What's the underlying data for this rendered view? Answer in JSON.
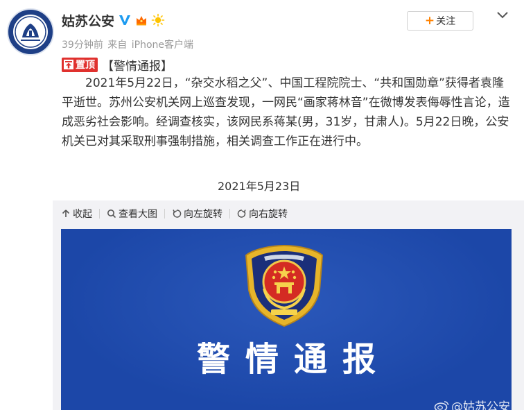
{
  "post": {
    "author_name": "姑苏公安",
    "time": "39分钟前",
    "source_prefix": "来自",
    "source_client": "iPhone客户端",
    "pin_label": "置顶",
    "tag": "【警情通报】",
    "body": "2021年5月22日，“杂交水稻之父”、中国工程院院士、“共和国勋章”获得者袁隆平逝世。苏州公安机关网上巡查发现，一网民“画家蒋林音”在微博发表侮辱性言论，造成恶劣社会影响。经调查核实，该网民系蒋某(男，31岁，甘肃人)。5月22日晚，公安机关已对其采取刑事强制措施，相关调查工作正在进行中。",
    "date": "2021年5月23日"
  },
  "header": {
    "follow_label": "关注",
    "follow_plus": "+"
  },
  "toolbar": {
    "collapse": "收起",
    "view_large": "查看大图",
    "rotate_left": "向左旋转",
    "rotate_right": "向右旋转"
  },
  "image": {
    "title": "警情通报",
    "watermark": "@姑苏公安"
  },
  "icons": {
    "verified": "verified-v-icon",
    "crown": "crown-icon",
    "sun": "sun-icon",
    "chevron": "chevron-down-icon",
    "pin": "pin-top-icon"
  },
  "colors": {
    "accent": "#ff8200",
    "pin_red": "#e0312e",
    "verified_blue": "#1d9bf0",
    "image_blue": "#1c47a8",
    "meta_gray": "#9a9a9a"
  }
}
